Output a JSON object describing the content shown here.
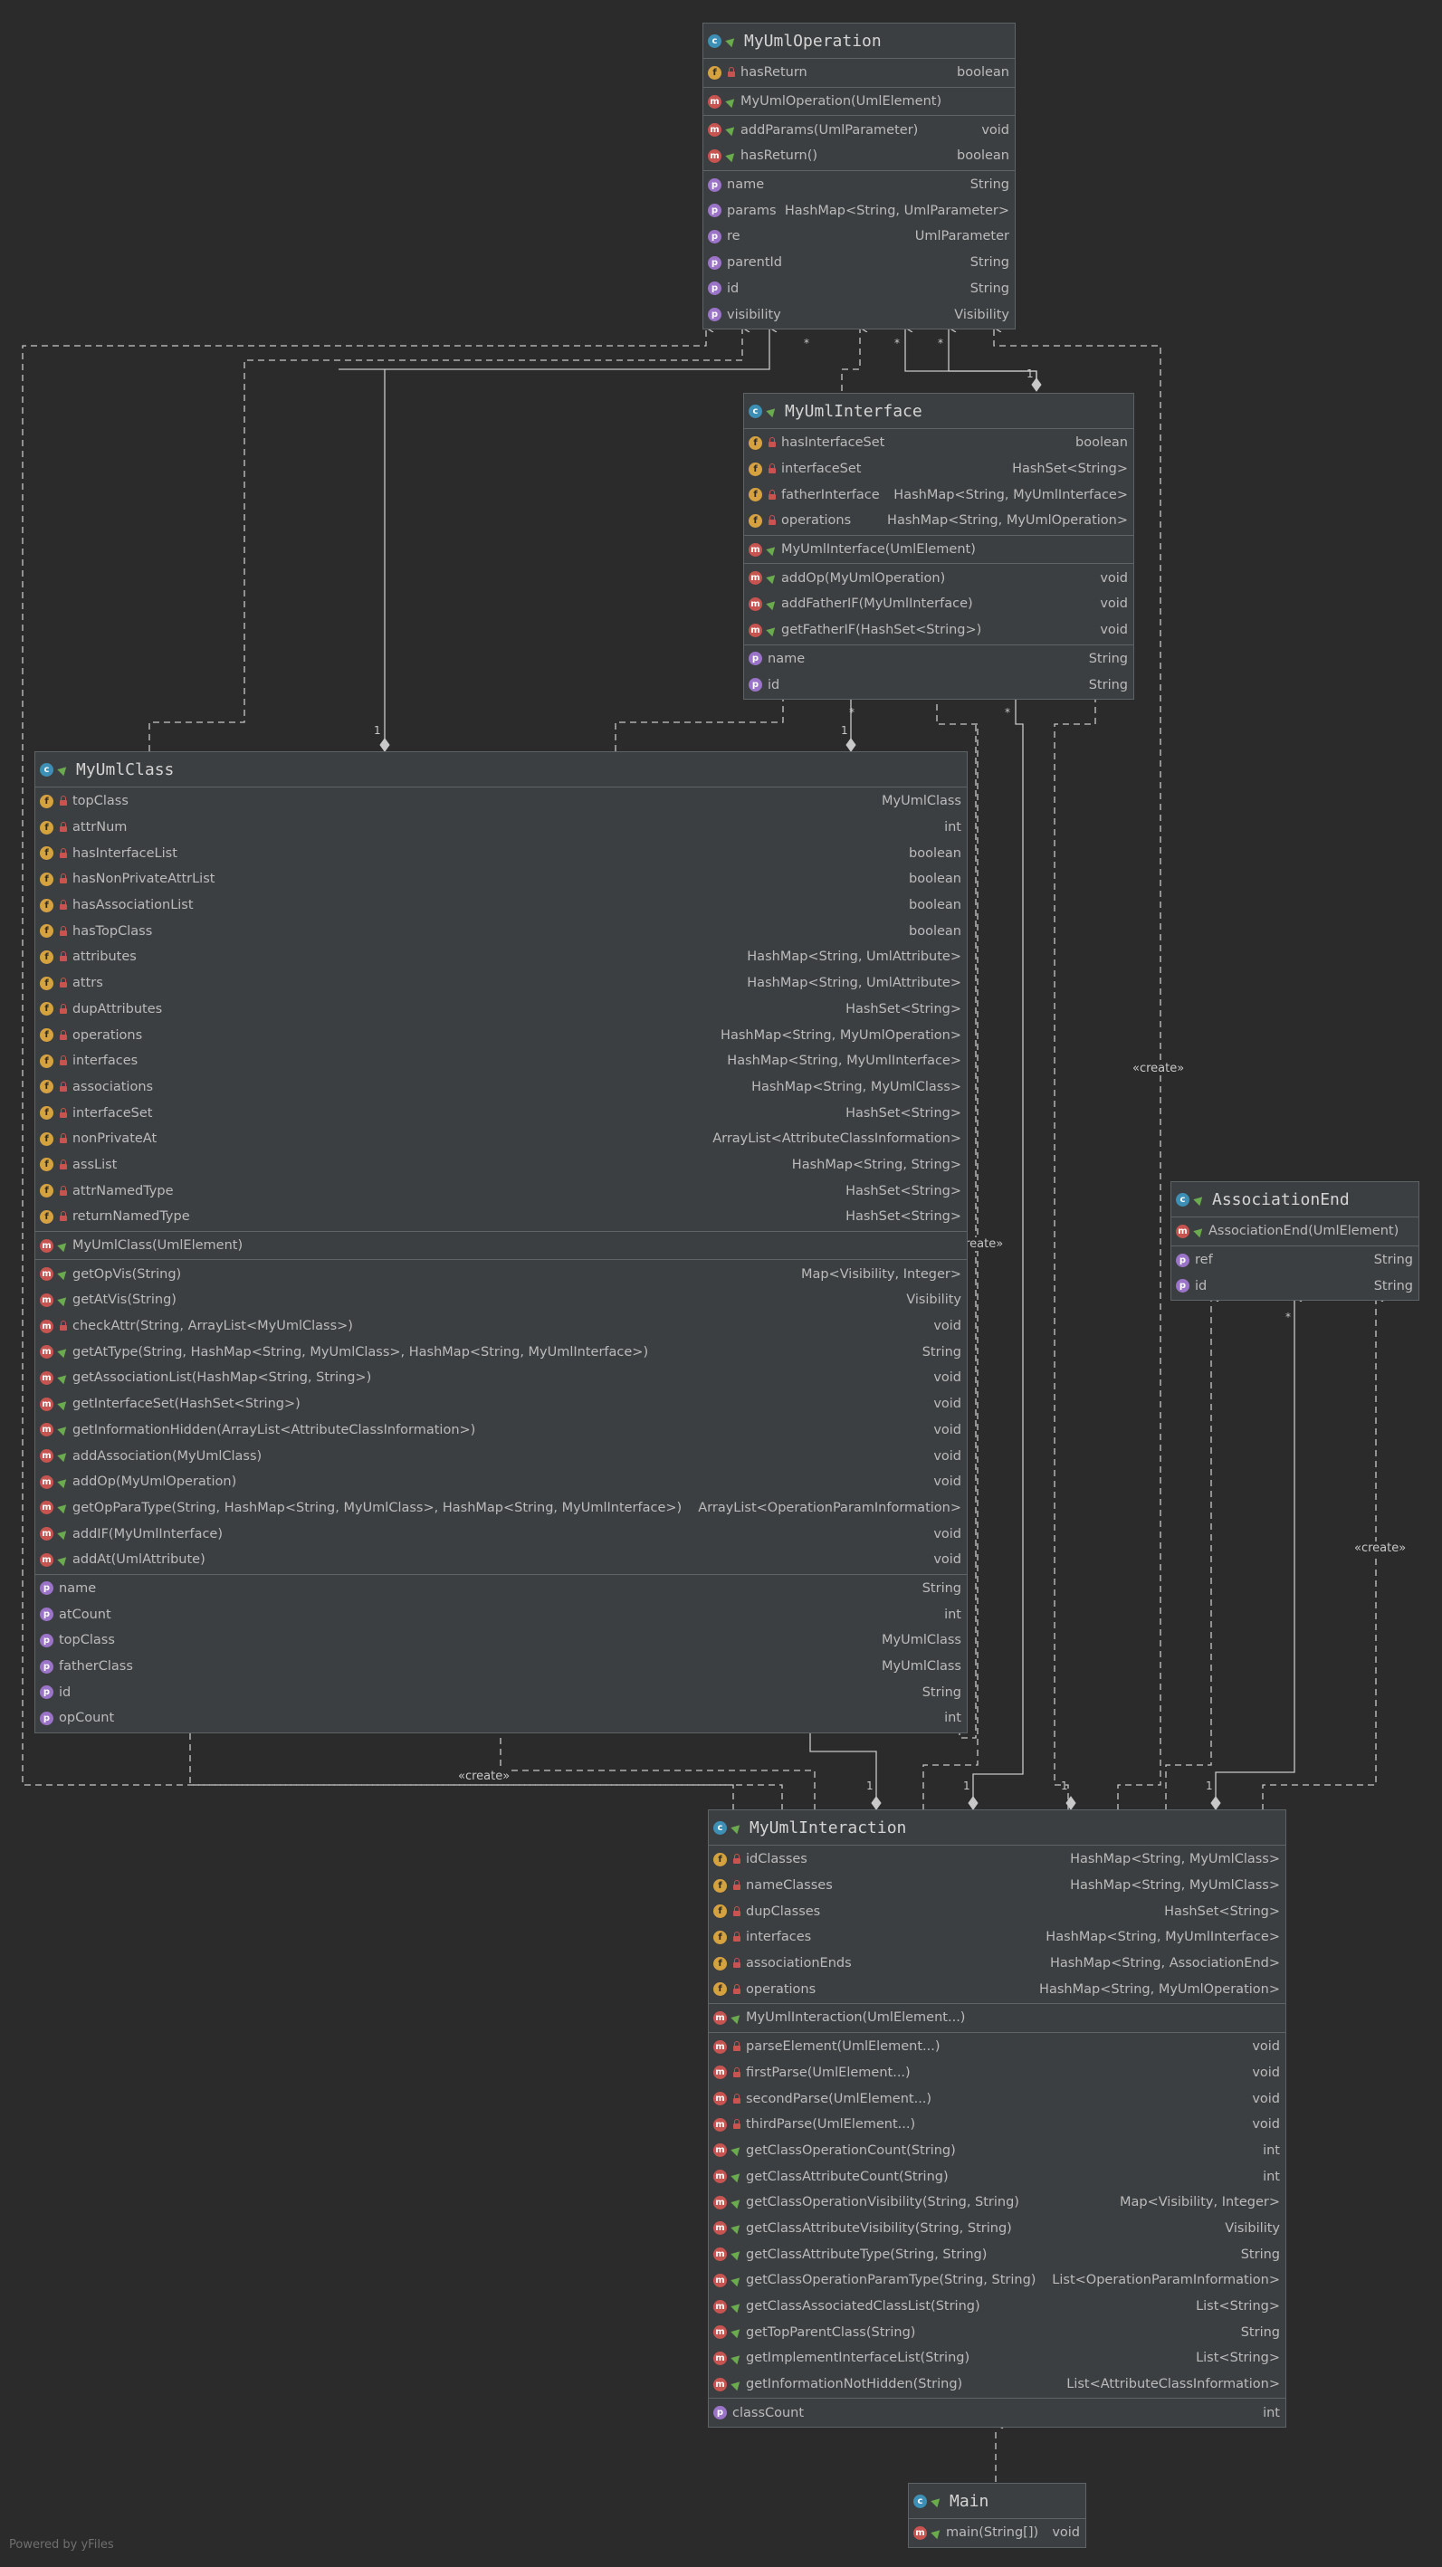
{
  "footer": "Powered by yFiles",
  "labels": {
    "create": "«create»",
    "one": "1",
    "many": "*"
  },
  "classes": [
    {
      "id": "op",
      "name": "MyUmlOperation",
      "sections": [
        [
          {
            "k": "f",
            "v": "lock",
            "n": "hasReturn",
            "t": "boolean"
          }
        ],
        [
          {
            "k": "m",
            "v": "pub",
            "n": "MyUmlOperation(UmlElement)",
            "t": ""
          }
        ],
        [
          {
            "k": "m",
            "v": "pub",
            "n": "addParams(UmlParameter)",
            "t": "void"
          },
          {
            "k": "m",
            "v": "pub",
            "n": "hasReturn()",
            "t": "boolean"
          }
        ],
        [
          {
            "k": "p",
            "v": "",
            "n": "name",
            "t": "String"
          },
          {
            "k": "p",
            "v": "",
            "n": "params",
            "t": "HashMap<String, UmlParameter>"
          },
          {
            "k": "p",
            "v": "",
            "n": "re",
            "t": "UmlParameter"
          },
          {
            "k": "p",
            "v": "",
            "n": "parentId",
            "t": "String"
          },
          {
            "k": "p",
            "v": "",
            "n": "id",
            "t": "String"
          },
          {
            "k": "p",
            "v": "",
            "n": "visibility",
            "t": "Visibility"
          }
        ]
      ]
    },
    {
      "id": "iface",
      "name": "MyUmlInterface",
      "sections": [
        [
          {
            "k": "f",
            "v": "lock",
            "n": "hasInterfaceSet",
            "t": "boolean"
          },
          {
            "k": "f",
            "v": "lock",
            "n": "interfaceSet",
            "t": "HashSet<String>"
          },
          {
            "k": "f",
            "v": "lock",
            "n": "fatherInterface",
            "t": "HashMap<String, MyUmlInterface>"
          },
          {
            "k": "f",
            "v": "lock",
            "n": "operations",
            "t": "HashMap<String, MyUmlOperation>"
          }
        ],
        [
          {
            "k": "m",
            "v": "pub",
            "n": "MyUmlInterface(UmlElement)",
            "t": ""
          }
        ],
        [
          {
            "k": "m",
            "v": "pub",
            "n": "addOp(MyUmlOperation)",
            "t": "void"
          },
          {
            "k": "m",
            "v": "pub",
            "n": "addFatherIF(MyUmlInterface)",
            "t": "void"
          },
          {
            "k": "m",
            "v": "pub",
            "n": "getFatherIF(HashSet<String>)",
            "t": "void"
          }
        ],
        [
          {
            "k": "p",
            "v": "",
            "n": "name",
            "t": "String"
          },
          {
            "k": "p",
            "v": "",
            "n": "id",
            "t": "String"
          }
        ]
      ]
    },
    {
      "id": "cls",
      "name": "MyUmlClass",
      "sections": [
        [
          {
            "k": "f",
            "v": "lock",
            "n": "topClass",
            "t": "MyUmlClass"
          },
          {
            "k": "f",
            "v": "lock",
            "n": "attrNum",
            "t": "int"
          },
          {
            "k": "f",
            "v": "lock",
            "n": "hasInterfaceList",
            "t": "boolean"
          },
          {
            "k": "f",
            "v": "lock",
            "n": "hasNonPrivateAttrList",
            "t": "boolean"
          },
          {
            "k": "f",
            "v": "lock",
            "n": "hasAssociationList",
            "t": "boolean"
          },
          {
            "k": "f",
            "v": "lock",
            "n": "hasTopClass",
            "t": "boolean"
          },
          {
            "k": "f",
            "v": "lock",
            "n": "attributes",
            "t": "HashMap<String, UmlAttribute>"
          },
          {
            "k": "f",
            "v": "lock",
            "n": "attrs",
            "t": "HashMap<String, UmlAttribute>"
          },
          {
            "k": "f",
            "v": "lock",
            "n": "dupAttributes",
            "t": "HashSet<String>"
          },
          {
            "k": "f",
            "v": "lock",
            "n": "operations",
            "t": "HashMap<String, MyUmlOperation>"
          },
          {
            "k": "f",
            "v": "lock",
            "n": "interfaces",
            "t": "HashMap<String, MyUmlInterface>"
          },
          {
            "k": "f",
            "v": "lock",
            "n": "associations",
            "t": "HashMap<String, MyUmlClass>"
          },
          {
            "k": "f",
            "v": "lock",
            "n": "interfaceSet",
            "t": "HashSet<String>"
          },
          {
            "k": "f",
            "v": "lock",
            "n": "nonPrivateAt",
            "t": "ArrayList<AttributeClassInformation>"
          },
          {
            "k": "f",
            "v": "lock",
            "n": "assList",
            "t": "HashMap<String, String>"
          },
          {
            "k": "f",
            "v": "lock",
            "n": "attrNamedType",
            "t": "HashSet<String>"
          },
          {
            "k": "f",
            "v": "lock",
            "n": "returnNamedType",
            "t": "HashSet<String>"
          }
        ],
        [
          {
            "k": "m",
            "v": "pub",
            "n": "MyUmlClass(UmlElement)",
            "t": ""
          }
        ],
        [
          {
            "k": "m",
            "v": "pub",
            "n": "getOpVis(String)",
            "t": "Map<Visibility, Integer>"
          },
          {
            "k": "m",
            "v": "pub",
            "n": "getAtVis(String)",
            "t": "Visibility"
          },
          {
            "k": "m",
            "v": "lock",
            "n": "checkAttr(String, ArrayList<MyUmlClass>)",
            "t": "void"
          },
          {
            "k": "m",
            "v": "pub",
            "n": "getAtType(String, HashMap<String, MyUmlClass>, HashMap<String, MyUmlInterface>)",
            "t": "String"
          },
          {
            "k": "m",
            "v": "pub",
            "n": "getAssociationList(HashMap<String, String>)",
            "t": "void"
          },
          {
            "k": "m",
            "v": "pub",
            "n": "getInterfaceSet(HashSet<String>)",
            "t": "void"
          },
          {
            "k": "m",
            "v": "pub",
            "n": "getInformationHidden(ArrayList<AttributeClassInformation>)",
            "t": "void"
          },
          {
            "k": "m",
            "v": "pub",
            "n": "addAssociation(MyUmlClass)",
            "t": "void"
          },
          {
            "k": "m",
            "v": "pub",
            "n": "addOp(MyUmlOperation)",
            "t": "void"
          },
          {
            "k": "m",
            "v": "pub",
            "n": "getOpParaType(String, HashMap<String, MyUmlClass>, HashMap<String, MyUmlInterface>)",
            "t": "ArrayList<OperationParamInformation>"
          },
          {
            "k": "m",
            "v": "pub",
            "n": "addIF(MyUmlInterface)",
            "t": "void"
          },
          {
            "k": "m",
            "v": "pub",
            "n": "addAt(UmlAttribute)",
            "t": "void"
          }
        ],
        [
          {
            "k": "p",
            "v": "",
            "n": "name",
            "t": "String"
          },
          {
            "k": "p",
            "v": "",
            "n": "atCount",
            "t": "int"
          },
          {
            "k": "p",
            "v": "",
            "n": "topClass",
            "t": "MyUmlClass"
          },
          {
            "k": "p",
            "v": "",
            "n": "fatherClass",
            "t": "MyUmlClass"
          },
          {
            "k": "p",
            "v": "",
            "n": "id",
            "t": "String"
          },
          {
            "k": "p",
            "v": "",
            "n": "opCount",
            "t": "int"
          }
        ]
      ]
    },
    {
      "id": "assoc",
      "name": "AssociationEnd",
      "sections": [
        [
          {
            "k": "m",
            "v": "pub",
            "n": "AssociationEnd(UmlElement)",
            "t": ""
          }
        ],
        [
          {
            "k": "p",
            "v": "",
            "n": "ref",
            "t": "String"
          },
          {
            "k": "p",
            "v": "",
            "n": "id",
            "t": "String"
          }
        ]
      ]
    },
    {
      "id": "inter",
      "name": "MyUmlInteraction",
      "sections": [
        [
          {
            "k": "f",
            "v": "lock",
            "n": "idClasses",
            "t": "HashMap<String, MyUmlClass>"
          },
          {
            "k": "f",
            "v": "lock",
            "n": "nameClasses",
            "t": "HashMap<String, MyUmlClass>"
          },
          {
            "k": "f",
            "v": "lock",
            "n": "dupClasses",
            "t": "HashSet<String>"
          },
          {
            "k": "f",
            "v": "lock",
            "n": "interfaces",
            "t": "HashMap<String, MyUmlInterface>"
          },
          {
            "k": "f",
            "v": "lock",
            "n": "associationEnds",
            "t": "HashMap<String, AssociationEnd>"
          },
          {
            "k": "f",
            "v": "lock",
            "n": "operations",
            "t": "HashMap<String, MyUmlOperation>"
          }
        ],
        [
          {
            "k": "m",
            "v": "pub",
            "n": "MyUmlInteraction(UmlElement...)",
            "t": ""
          }
        ],
        [
          {
            "k": "m",
            "v": "lock",
            "n": "parseElement(UmlElement...)",
            "t": "void"
          },
          {
            "k": "m",
            "v": "lock",
            "n": "firstParse(UmlElement...)",
            "t": "void"
          },
          {
            "k": "m",
            "v": "lock",
            "n": "secondParse(UmlElement...)",
            "t": "void"
          },
          {
            "k": "m",
            "v": "lock",
            "n": "thirdParse(UmlElement...)",
            "t": "void"
          },
          {
            "k": "m",
            "v": "pub",
            "n": "getClassOperationCount(String)",
            "t": "int"
          },
          {
            "k": "m",
            "v": "pub",
            "n": "getClassAttributeCount(String)",
            "t": "int"
          },
          {
            "k": "m",
            "v": "pub",
            "n": "getClassOperationVisibility(String, String)",
            "t": "Map<Visibility, Integer>"
          },
          {
            "k": "m",
            "v": "pub",
            "n": "getClassAttributeVisibility(String, String)",
            "t": "Visibility"
          },
          {
            "k": "m",
            "v": "pub",
            "n": "getClassAttributeType(String, String)",
            "t": "String"
          },
          {
            "k": "m",
            "v": "pub",
            "n": "getClassOperationParamType(String, String)",
            "t": "List<OperationParamInformation>"
          },
          {
            "k": "m",
            "v": "pub",
            "n": "getClassAssociatedClassList(String)",
            "t": "List<String>"
          },
          {
            "k": "m",
            "v": "pub",
            "n": "getTopParentClass(String)",
            "t": "String"
          },
          {
            "k": "m",
            "v": "pub",
            "n": "getImplementInterfaceList(String)",
            "t": "List<String>"
          },
          {
            "k": "m",
            "v": "pub",
            "n": "getInformationNotHidden(String)",
            "t": "List<AttributeClassInformation>"
          }
        ],
        [
          {
            "k": "p",
            "v": "",
            "n": "classCount",
            "t": "int"
          }
        ]
      ]
    },
    {
      "id": "main",
      "name": "Main",
      "sections": [
        [
          {
            "k": "m",
            "v": "pub",
            "n": "main(String[])",
            "t": "void"
          }
        ]
      ]
    }
  ]
}
